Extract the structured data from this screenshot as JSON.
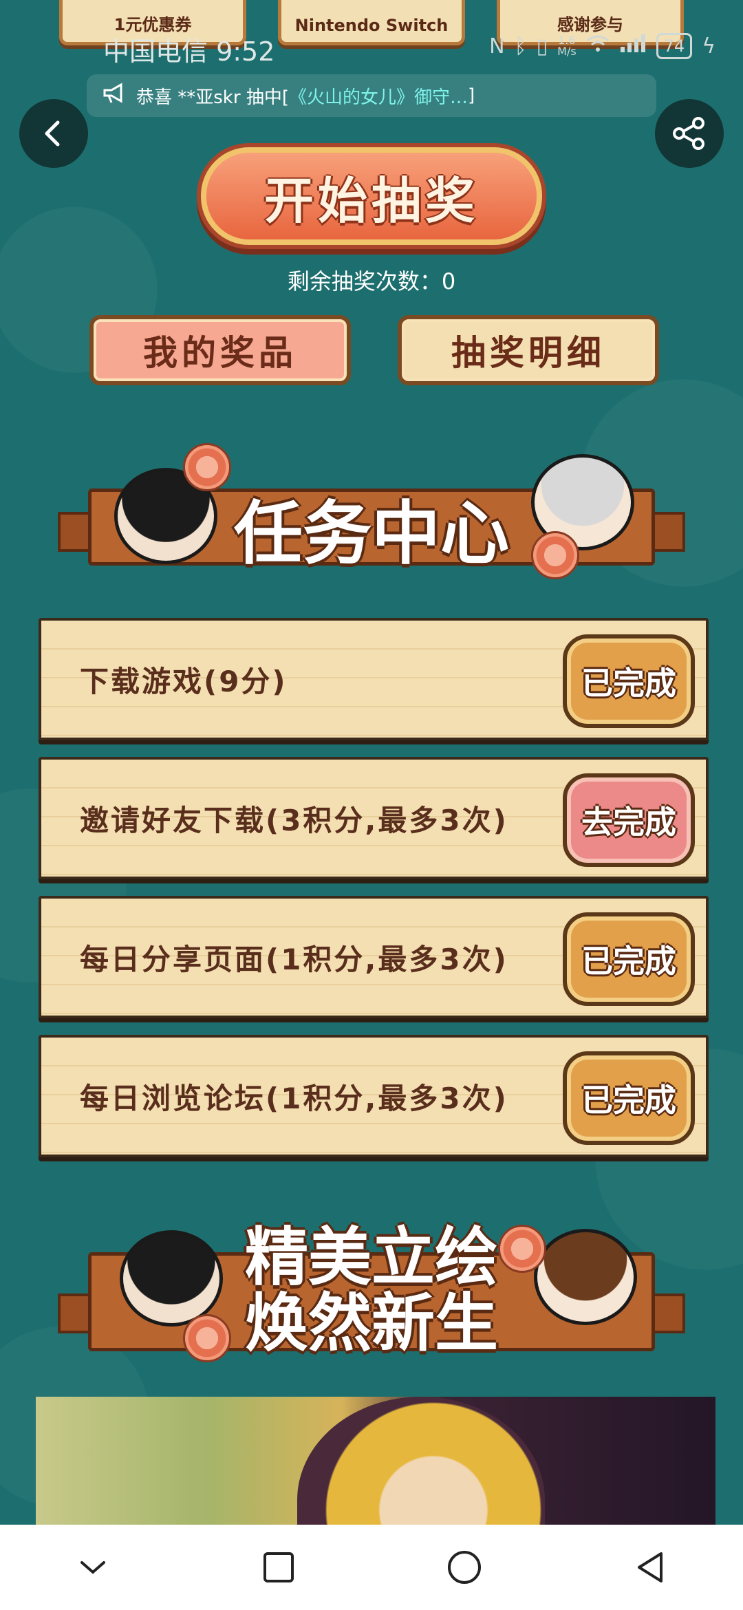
{
  "prize_tiles": [
    {
      "label": "1元优惠券"
    },
    {
      "label": "Nintendo Switch"
    },
    {
      "label": "感谢参与"
    }
  ],
  "status_bar": {
    "carrier_time": "中国电信 9:52",
    "net_speed_value": "1.6",
    "net_speed_unit": "M/s",
    "battery": "74"
  },
  "marquee": {
    "prefix": "恭喜 **亚skr 抽中[",
    "highlight": "《火山的女儿》御守…",
    "suffix": "]"
  },
  "draw": {
    "start_label": "开始抽奖",
    "remaining_label": "剩余抽奖次数：0"
  },
  "actions": {
    "my_prizes": "我的奖品",
    "draw_details": "抽奖明细"
  },
  "task_center": {
    "title": "任务中心",
    "tasks": [
      {
        "text": "下载游戏(9分)",
        "button": "已完成",
        "state": "done"
      },
      {
        "text": "邀请好友下载(3积分,最多3次)",
        "button": "去完成",
        "state": "todo"
      },
      {
        "text": "每日分享页面(1积分,最多3次)",
        "button": "已完成",
        "state": "done"
      },
      {
        "text": "每日浏览论坛(1积分,最多3次)",
        "button": "已完成",
        "state": "done"
      }
    ]
  },
  "artwork": {
    "title_line1": "精美立绘",
    "title_line2": "焕然新生"
  },
  "colors": {
    "background": "#1d6f6f",
    "accent_orange": "#e8663f",
    "done_button": "#e2a04a",
    "todo_button": "#ec8a8a"
  }
}
